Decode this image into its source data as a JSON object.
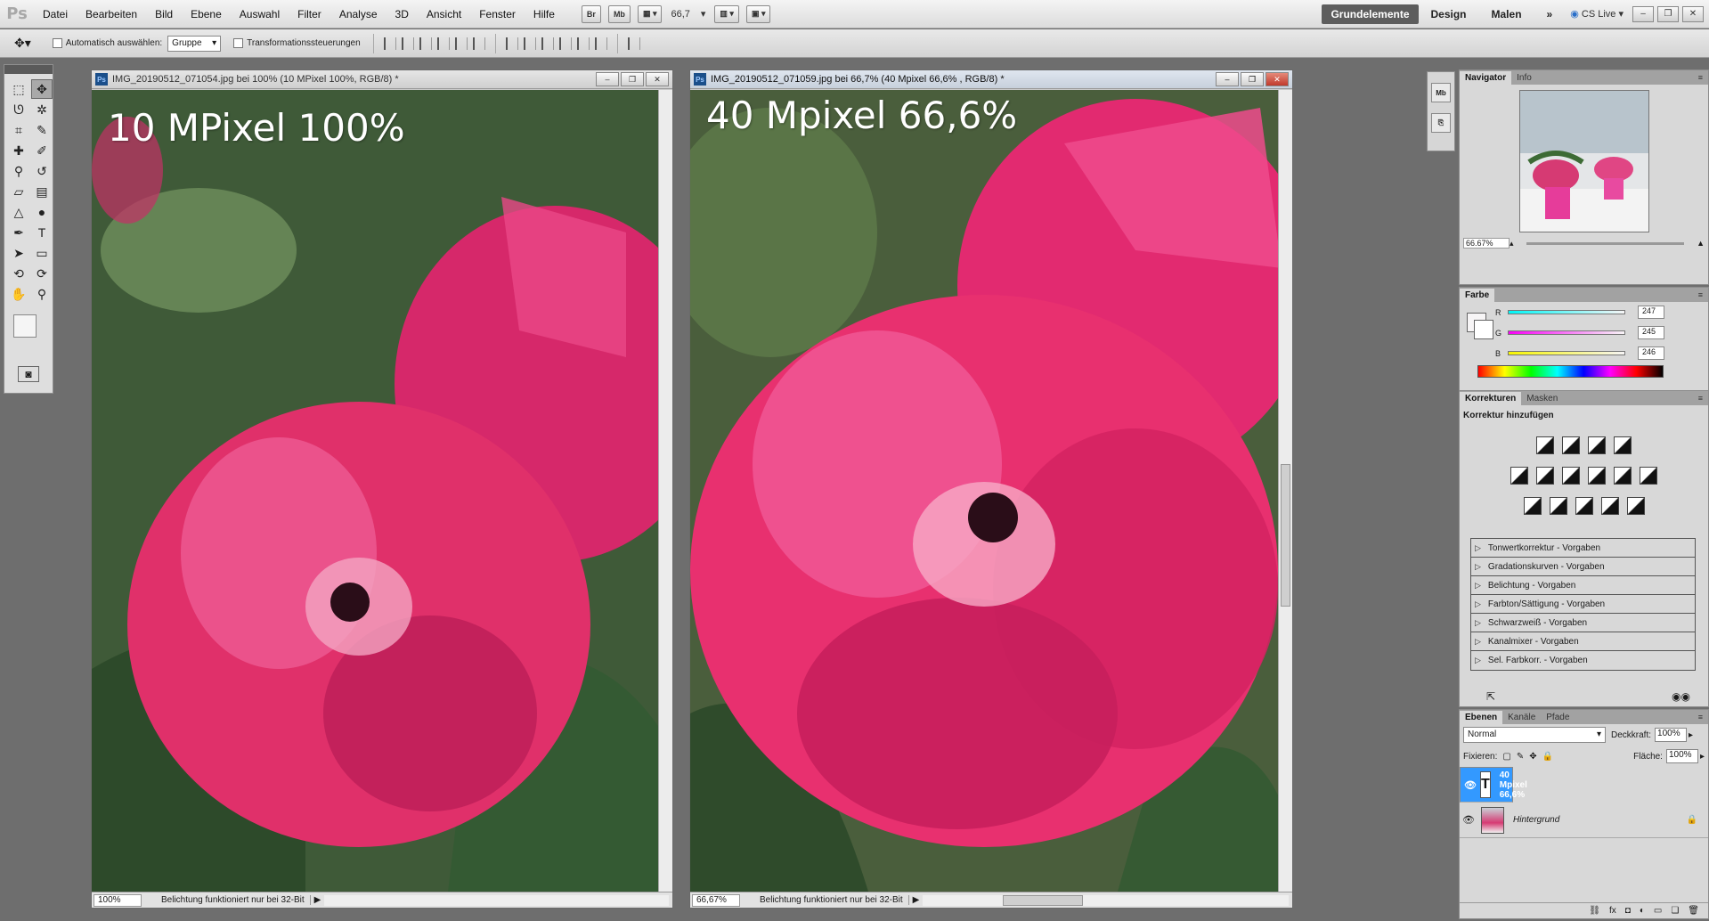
{
  "menu": {
    "logo": "Ps",
    "items": [
      "Datei",
      "Bearbeiten",
      "Bild",
      "Ebene",
      "Auswahl",
      "Filter",
      "Analyse",
      "3D",
      "Ansicht",
      "Fenster",
      "Hilfe"
    ],
    "bridge": "Br",
    "minibridge": "Mb",
    "zoom": "66,7",
    "workspace_active": "Grundelemente",
    "workspaces": [
      "Design",
      "Malen"
    ],
    "more": "»",
    "cslive": "CS Live"
  },
  "options": {
    "auto_select_label": "Automatisch auswählen:",
    "auto_select_value": "Gruppe",
    "transform_label": "Transformationssteuerungen"
  },
  "doc_left": {
    "title": "IMG_20190512_071054.jpg bei 100% (10 MPixel 100%, RGB/8) *",
    "overlay": "10 MPixel 100%",
    "zoom": "100%",
    "status": "Belichtung funktioniert nur bei 32-Bit"
  },
  "doc_right": {
    "title": "IMG_20190512_071059.jpg bei 66,7% (40 Mpixel 66,6% , RGB/8) *",
    "overlay": "40 Mpixel 66,6%",
    "zoom": "66,67%",
    "status": "Belichtung funktioniert nur bei 32-Bit"
  },
  "navigator": {
    "tabs": [
      "Navigator",
      "Info"
    ],
    "zoom": "66.67%"
  },
  "farbe": {
    "tab": "Farbe",
    "r_label": "R",
    "g_label": "G",
    "b_label": "B",
    "r": "247",
    "g": "245",
    "b": "246"
  },
  "korrekturen": {
    "tabs": [
      "Korrekturen",
      "Masken"
    ],
    "title": "Korrektur hinzufügen",
    "presets": [
      "Tonwertkorrektur - Vorgaben",
      "Gradationskurven - Vorgaben",
      "Belichtung - Vorgaben",
      "Farbton/Sättigung - Vorgaben",
      "Schwarzweiß - Vorgaben",
      "Kanalmixer - Vorgaben",
      "Sel. Farbkorr. - Vorgaben"
    ]
  },
  "ebenen": {
    "tabs": [
      "Ebenen",
      "Kanäle",
      "Pfade"
    ],
    "blend_mode": "Normal",
    "opacity_label": "Deckkraft:",
    "opacity": "100%",
    "lock_label": "Fixieren:",
    "fill_label": "Fläche:",
    "fill": "100%",
    "layers": [
      {
        "name": "40 Mpixel 66,6%",
        "type": "T"
      },
      {
        "name": "Hintergrund",
        "type": "image"
      }
    ]
  },
  "colors": {
    "selected_layer": "#3399ff",
    "flower": "#e0306a"
  }
}
